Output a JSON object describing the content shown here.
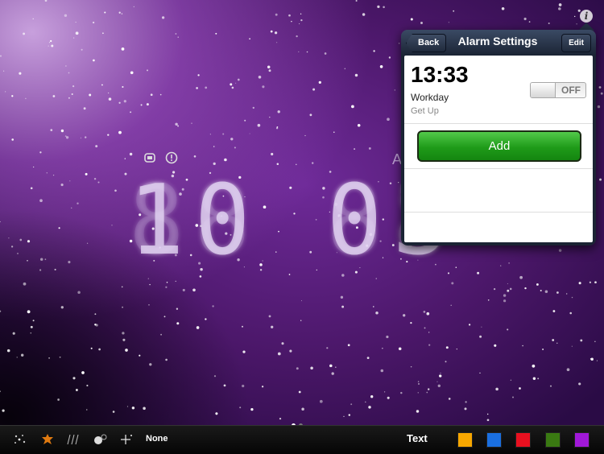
{
  "clock": {
    "time_digits": "10 03",
    "ghost_digits": "88 88",
    "ampm_partial": "A",
    "status_icons": [
      "battery-icon",
      "alarm-clock-icon"
    ]
  },
  "popover": {
    "title": "Alarm Settings",
    "back_label": "Back",
    "edit_label": "Edit",
    "info_glyph": "i",
    "alarm": {
      "time": "13:33",
      "label": "Workday",
      "sublabel": "Get Up",
      "toggle_label": "OFF"
    },
    "add_label": "Add"
  },
  "toolbar": {
    "icons": [
      "sparkle-icon",
      "leaf-icon",
      "rain-icon",
      "bubble-icon",
      "plus-star-icon"
    ],
    "effect_label": "None",
    "text_label": "Text",
    "swatches": [
      {
        "name": "orange",
        "color": "#f7a700"
      },
      {
        "name": "blue",
        "color": "#1a6fe0"
      },
      {
        "name": "red",
        "color": "#e8101f"
      },
      {
        "name": "green",
        "color": "#3a7a12"
      },
      {
        "name": "purple",
        "color": "#a018d8"
      }
    ]
  }
}
